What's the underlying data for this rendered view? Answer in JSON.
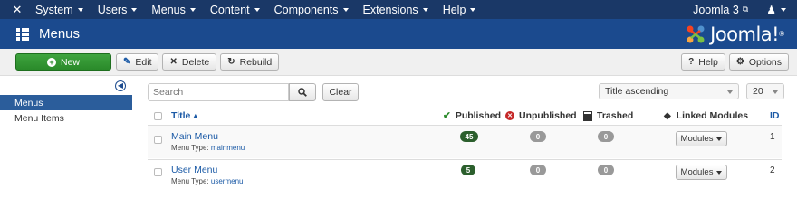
{
  "topnav": {
    "items": [
      {
        "label": "System"
      },
      {
        "label": "Users"
      },
      {
        "label": "Menus"
      },
      {
        "label": "Content"
      },
      {
        "label": "Components"
      },
      {
        "label": "Extensions"
      },
      {
        "label": "Help"
      }
    ],
    "site_name": "Joomla 3"
  },
  "titlebar": {
    "title": "Menus",
    "brand": "Joomla!",
    "brand_mark": "®"
  },
  "toolbar": {
    "new_label": "New",
    "edit_label": "Edit",
    "delete_label": "Delete",
    "rebuild_label": "Rebuild",
    "help_label": "Help",
    "options_label": "Options"
  },
  "sidebar": {
    "items": [
      {
        "label": "Menus",
        "active": true
      },
      {
        "label": "Menu Items",
        "active": false
      }
    ]
  },
  "filters": {
    "search_placeholder": "Search",
    "clear_label": "Clear",
    "sort_value": "Title ascending",
    "limit_value": "20"
  },
  "table": {
    "headers": {
      "title": "Title",
      "published": "Published",
      "unpublished": "Unpublished",
      "trashed": "Trashed",
      "linked_modules": "Linked Modules",
      "id": "ID"
    },
    "rows": [
      {
        "title": "Main Menu",
        "menu_type_label": "Menu Type:",
        "menu_type": "mainmenu",
        "published": "45",
        "unpublished": "0",
        "trashed": "0",
        "modules_label": "Modules",
        "id": "1"
      },
      {
        "title": "User Menu",
        "menu_type_label": "Menu Type:",
        "menu_type": "usermenu",
        "published": "5",
        "unpublished": "0",
        "trashed": "0",
        "modules_label": "Modules",
        "id": "2"
      }
    ]
  },
  "colors": {
    "topnav_bg": "#1a3867",
    "titlebar_bg": "#1b4a8e",
    "new_button": "#2a8a2a",
    "published_badge": "#2c5f2d",
    "count_badge": "#999999",
    "link": "#1b5aa6"
  }
}
